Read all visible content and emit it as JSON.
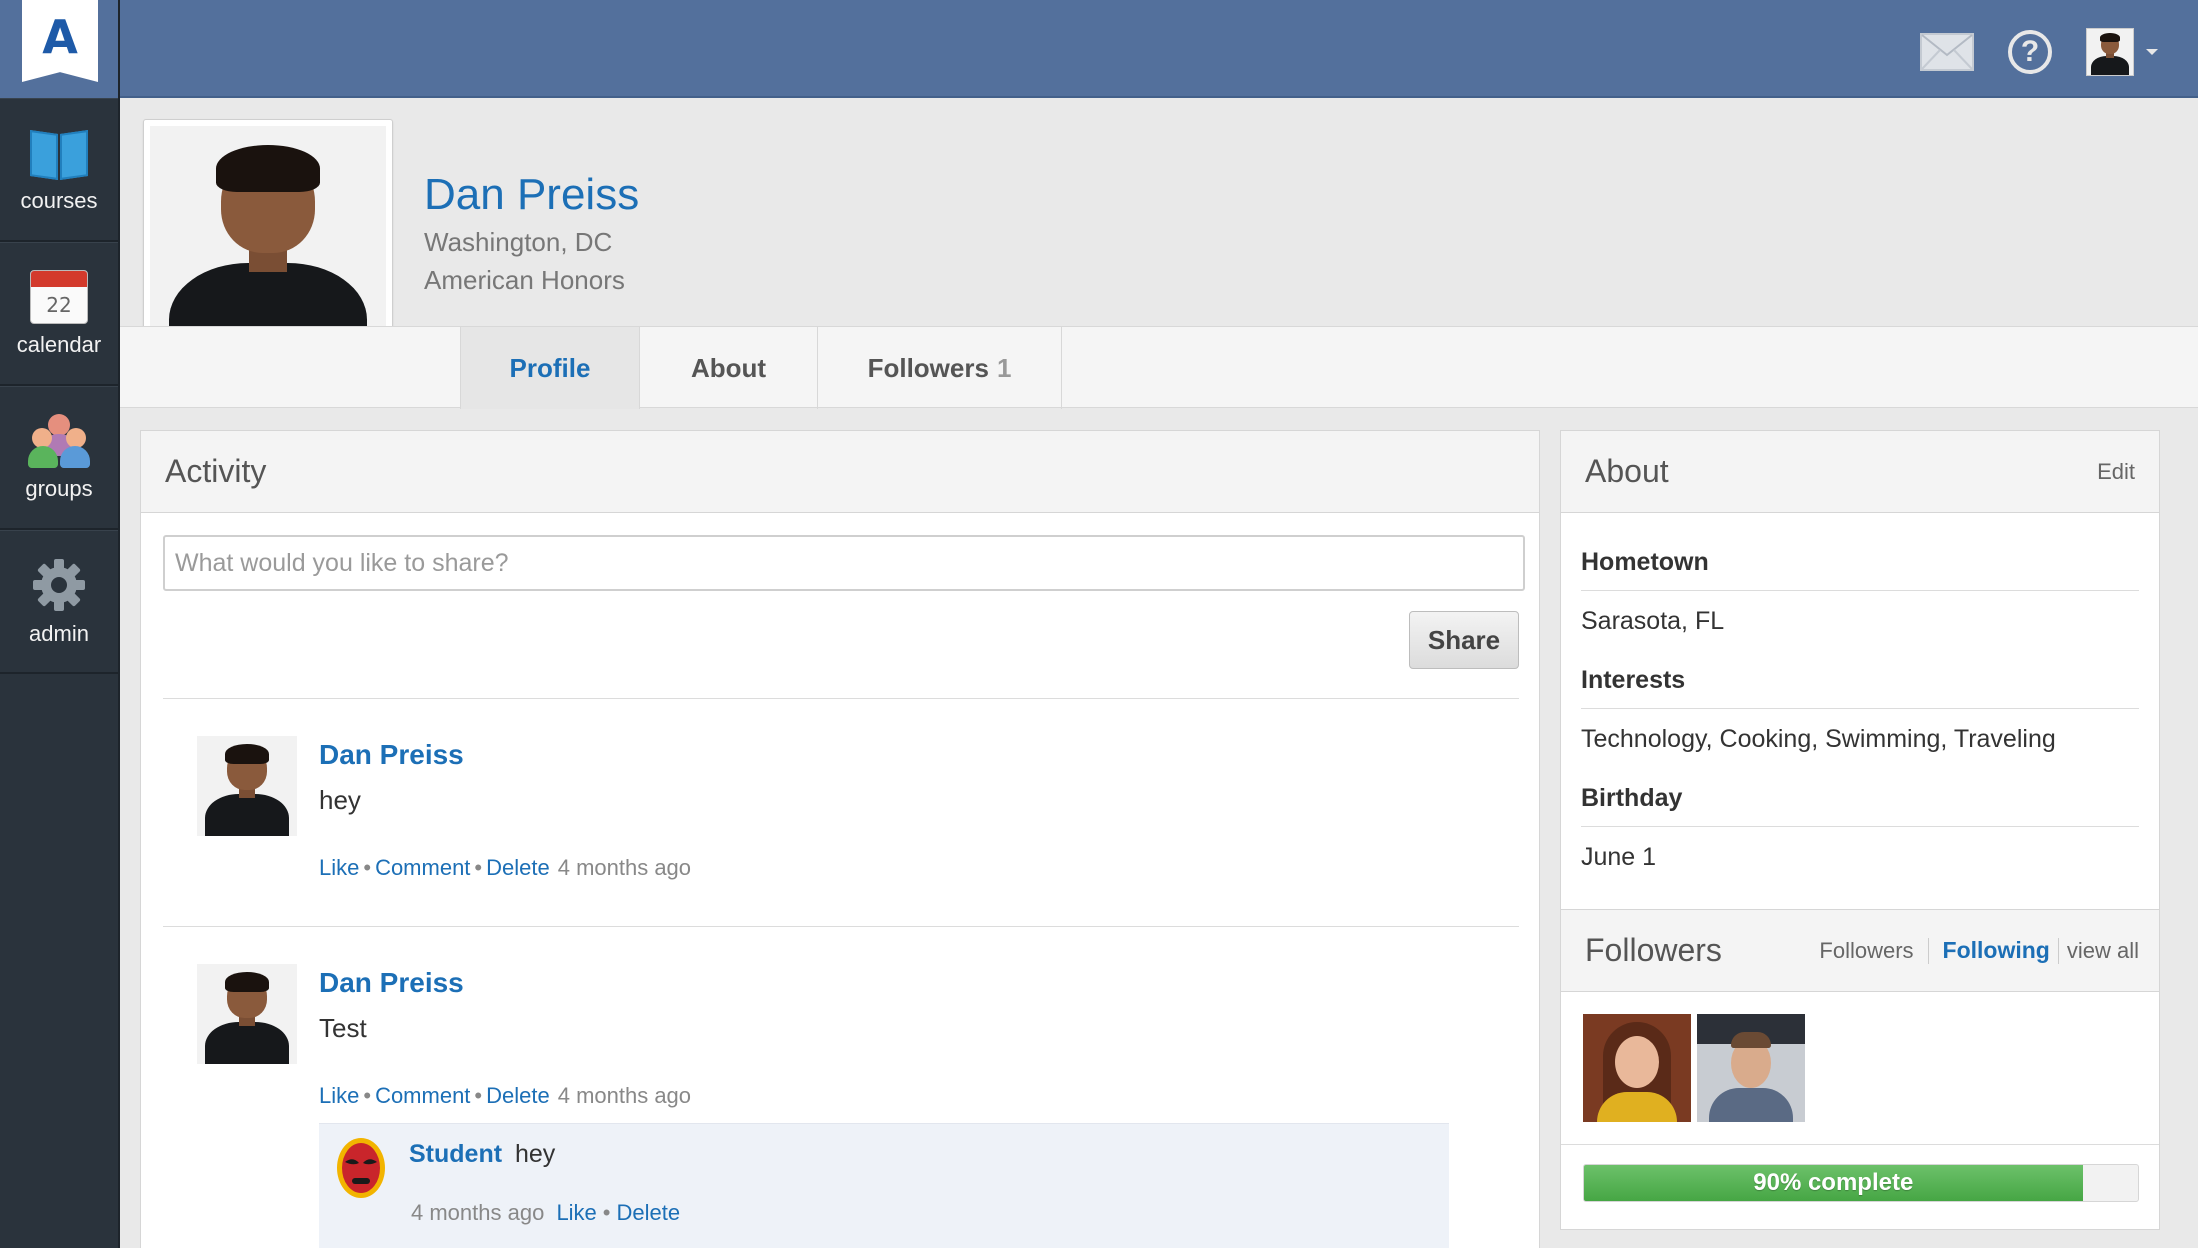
{
  "app": {
    "logo_letter": "A"
  },
  "sidebar": {
    "items": [
      {
        "label": "courses",
        "icon": "book-icon"
      },
      {
        "label": "calendar",
        "icon": "calendar-icon",
        "day": "22"
      },
      {
        "label": "groups",
        "icon": "groups-icon"
      },
      {
        "label": "admin",
        "icon": "gear-icon"
      }
    ]
  },
  "topbar": {
    "icons": [
      "mail-icon",
      "help-icon",
      "user-avatar"
    ],
    "help_glyph": "?"
  },
  "profile": {
    "name": "Dan Preiss",
    "location": "Washington, DC",
    "organization": "American Honors"
  },
  "tabs": [
    {
      "label": "Profile",
      "active": true
    },
    {
      "label": "About",
      "active": false
    },
    {
      "label": "Followers",
      "count": "1",
      "active": false
    }
  ],
  "activity": {
    "title": "Activity",
    "share_placeholder": "What would you like to share?",
    "share_button": "Share",
    "posts": [
      {
        "author": "Dan Preiss",
        "text": "hey",
        "actions": {
          "like": "Like",
          "comment": "Comment",
          "delete": "Delete"
        },
        "time": "4 months ago"
      },
      {
        "author": "Dan Preiss",
        "text": "Test",
        "actions": {
          "like": "Like",
          "comment": "Comment",
          "delete": "Delete"
        },
        "time": "4 months ago",
        "comments": [
          {
            "author": "Student",
            "text": "hey",
            "time": "4 months ago",
            "actions": {
              "like": "Like",
              "delete": "Delete"
            }
          }
        ]
      }
    ]
  },
  "about": {
    "title": "About",
    "edit_label": "Edit",
    "fields": [
      {
        "label": "Hometown",
        "value": "Sarasota, FL"
      },
      {
        "label": "Interests",
        "value": "Technology, Cooking, Swimming, Traveling"
      },
      {
        "label": "Birthday",
        "value": "June 1"
      }
    ]
  },
  "followers_panel": {
    "title": "Followers",
    "links": {
      "followers": "Followers",
      "following": "Following",
      "view_all": "view all"
    },
    "progress": {
      "value": 0.9,
      "label": "90% complete"
    }
  },
  "colors": {
    "accent": "#1c6fb6",
    "topbar": "#53709c",
    "sidebar": "#2a333c",
    "progress": "#46a644"
  }
}
